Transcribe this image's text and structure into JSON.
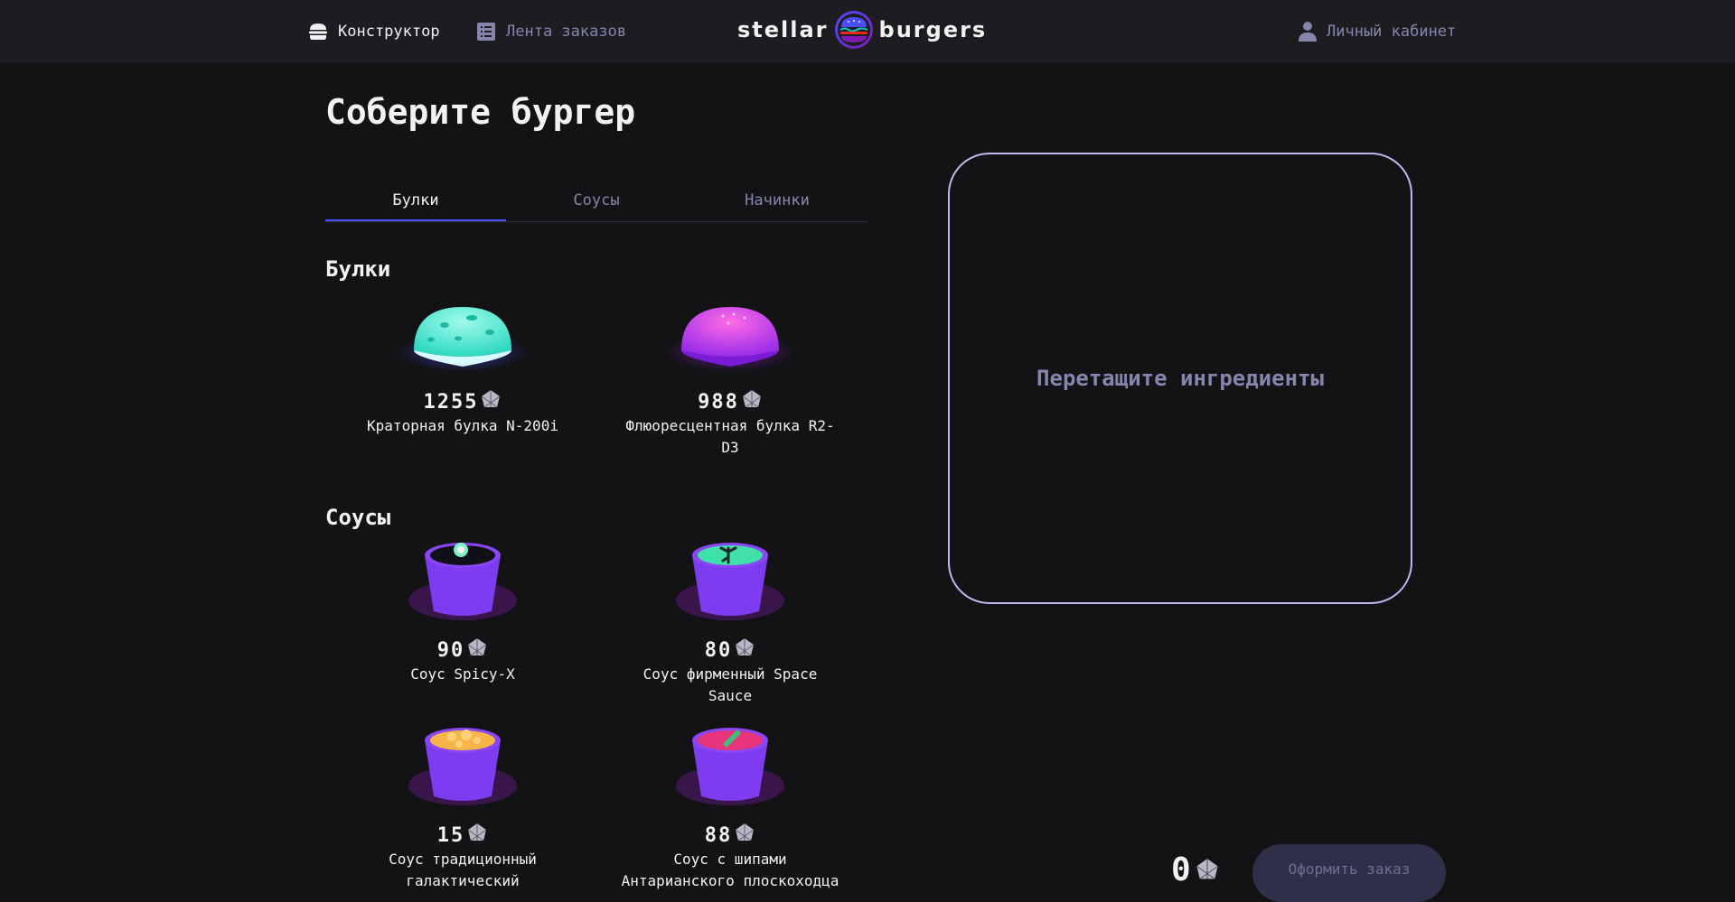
{
  "header": {
    "nav": [
      {
        "label": "Конструктор",
        "icon": "burger-icon",
        "active": true
      },
      {
        "label": "Лента заказов",
        "icon": "list-icon",
        "active": false
      }
    ],
    "logo": {
      "left": "stellar",
      "right": "burgers"
    },
    "profile": {
      "label": "Личный кабинет",
      "icon": "profile-icon"
    }
  },
  "main": {
    "title": "Соберите бургер",
    "tabs": [
      {
        "label": "Булки",
        "active": true
      },
      {
        "label": "Соусы",
        "active": false
      },
      {
        "label": "Начинки",
        "active": false
      }
    ],
    "sections": [
      {
        "title": "Булки",
        "items": [
          {
            "price": "1255",
            "name": "Краторная булка N-200i",
            "image": "crater-bun-image"
          },
          {
            "price": "988",
            "name": "Флюоресцентная булка R2-D3",
            "image": "fluorescent-bun-image"
          }
        ]
      },
      {
        "title": "Соусы",
        "items": [
          {
            "price": "90",
            "name": "Соус Spicy-X",
            "image": "spicy-sauce-image"
          },
          {
            "price": "80",
            "name": "Соус фирменный Space Sauce",
            "image": "space-sauce-image"
          },
          {
            "price": "15",
            "name": "Соус традиционный галактический",
            "image": "galactic-sauce-image"
          },
          {
            "price": "88",
            "name": "Соус с шипами Антарианского плоскоходца",
            "image": "spiked-sauce-image"
          }
        ]
      }
    ]
  },
  "constructor": {
    "placeholder": "Перетащите ингредиенты",
    "total": "0",
    "order_button": "Оформить заказ"
  },
  "colors": {
    "background": "#131316",
    "header": "#1c1c21",
    "accent": "#4c4cff",
    "inactive_text": "#8585ad",
    "dropzone_border": "#c5b7f0"
  }
}
